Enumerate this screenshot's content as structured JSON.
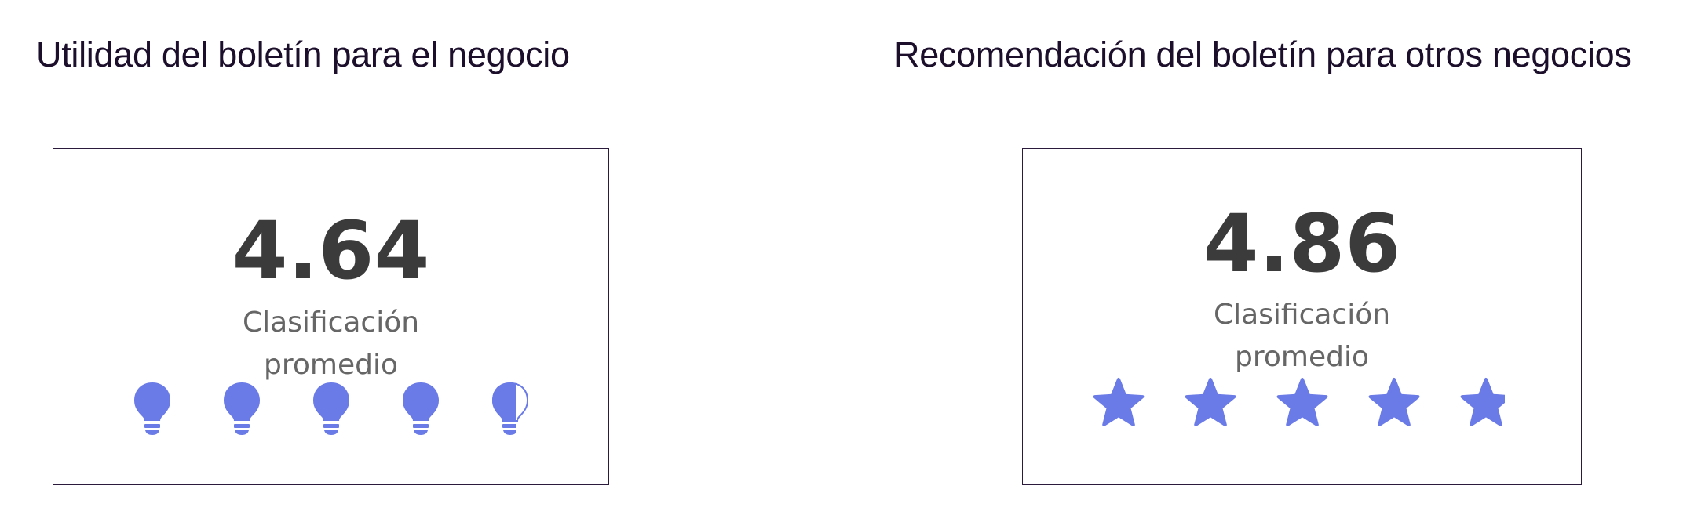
{
  "panels": [
    {
      "title": "Utilidad del boletín para el negocio",
      "value": "4.64",
      "caption_line1": "Clasificación",
      "caption_line2": "promedio",
      "icon": "lightbulb-icon",
      "rating": 4.64,
      "max": 5
    },
    {
      "title": "Recomendación del boletín para otros negocios",
      "value": "4.86",
      "caption_line1": "Clasificación",
      "caption_line2": "promedio",
      "icon": "star-icon",
      "rating": 4.86,
      "max": 5
    }
  ],
  "colors": {
    "icon_fill": "#6a7ae7",
    "value_text": "#3b3b3b",
    "caption_text": "#666666",
    "title_text": "#1c0f2c",
    "border": "#2b1a3c"
  }
}
